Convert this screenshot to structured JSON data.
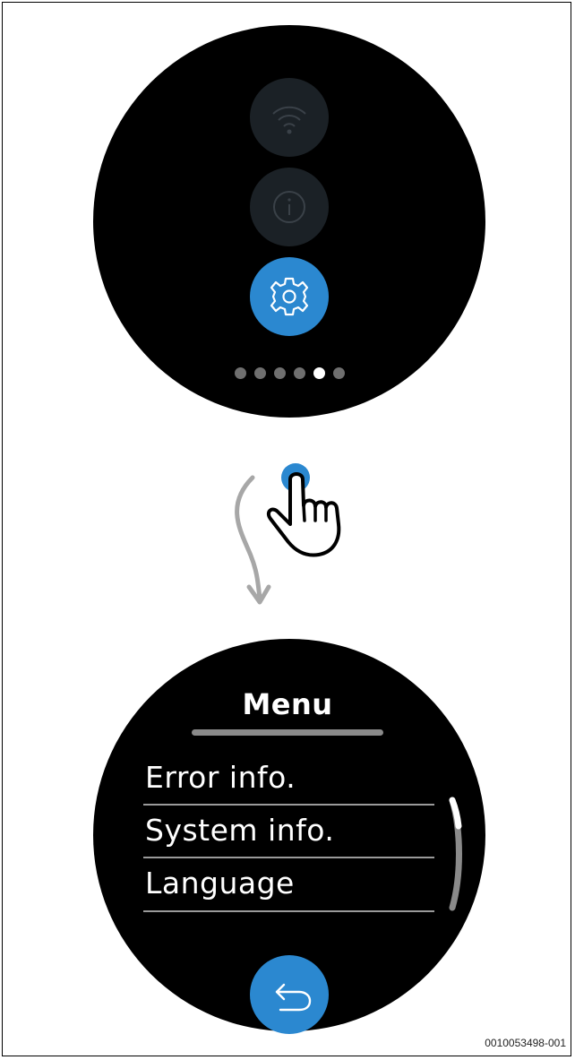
{
  "screen_top": {
    "buttons": [
      {
        "icon": "wifi-icon",
        "state": "disabled"
      },
      {
        "icon": "info-icon",
        "state": "disabled"
      },
      {
        "icon": "gear-icon",
        "state": "active"
      }
    ],
    "page_indicator": {
      "total": 6,
      "active_index": 5
    }
  },
  "gesture": {
    "hand_icon": "tap-hand-icon",
    "arrow_icon": "swipe-down-arrow-icon"
  },
  "screen_bottom": {
    "title": "Menu",
    "items": [
      {
        "label": "Error info."
      },
      {
        "label": "System info."
      },
      {
        "label": "Language"
      }
    ],
    "back_icon": "back-arrow-icon"
  },
  "colors": {
    "accent": "#2b88d0",
    "screen_bg": "#000000",
    "dim_button": "#1b2126"
  },
  "figure_id": "0010053498-001"
}
